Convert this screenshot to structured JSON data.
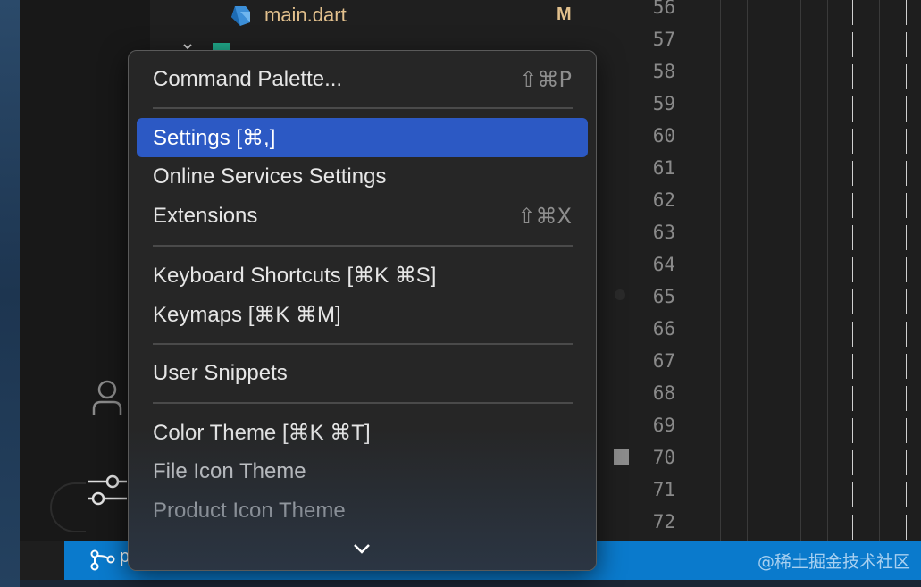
{
  "explorer": {
    "file_name": "main.dart",
    "file_status": "M"
  },
  "gutter": {
    "line_numbers": [
      "56",
      "57",
      "58",
      "59",
      "60",
      "61",
      "62",
      "63",
      "64",
      "65",
      "66",
      "67",
      "68",
      "69",
      "70",
      "71",
      "72"
    ]
  },
  "status_bar": {
    "branch_label": "p",
    "watermark": "@稀土掘金技术社区"
  },
  "menu": {
    "items": [
      {
        "label": "Command Palette...",
        "shortcut": "⇧⌘P",
        "selected": false
      },
      {
        "label": "Settings [⌘,]",
        "shortcut": "",
        "selected": true
      },
      {
        "label": "Online Services Settings",
        "shortcut": "",
        "selected": false
      },
      {
        "label": "Extensions",
        "shortcut": "⇧⌘X",
        "selected": false
      },
      {
        "label": "Keyboard Shortcuts [⌘K ⌘S]",
        "shortcut": "",
        "selected": false
      },
      {
        "label": "Keymaps [⌘K ⌘M]",
        "shortcut": "",
        "selected": false
      },
      {
        "label": "User Snippets",
        "shortcut": "",
        "selected": false
      },
      {
        "label": "Color Theme [⌘K ⌘T]",
        "shortcut": "",
        "selected": false
      },
      {
        "label": "File Icon Theme",
        "shortcut": "",
        "selected": false
      },
      {
        "label": "Product Icon Theme",
        "shortcut": "",
        "selected": false
      }
    ]
  },
  "icons": {
    "file": "dart-icon",
    "account": "account-icon",
    "settings": "settings-sliders-icon",
    "branch": "source-control-branch-icon",
    "more": "chevron-down-icon"
  },
  "colors": {
    "selection": "#2c59c4",
    "status_bar": "#0a7acc",
    "modified": "#e2c08d"
  }
}
